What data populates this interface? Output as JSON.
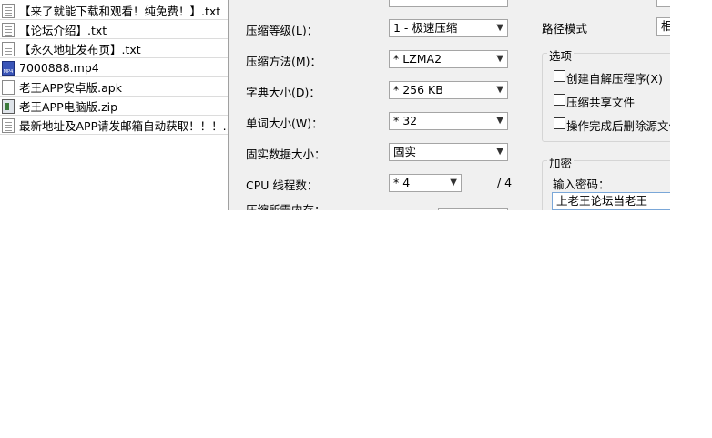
{
  "files": [
    {
      "name": "【来了就能下载和观看！纯免费！】.txt",
      "icon": "txt-file-icon"
    },
    {
      "name": "【论坛介绍】.txt",
      "icon": "txt-file-icon"
    },
    {
      "name": "【永久地址发布页】.txt",
      "icon": "txt-file-icon"
    },
    {
      "name": "7000888.mp4",
      "icon": "mp4-file-icon",
      "icon_text": "MP4"
    },
    {
      "name": "老王APP安卓版.apk",
      "icon": "apk-file-icon"
    },
    {
      "name": "老王APP电脑版.zip",
      "icon": "zip-file-icon"
    },
    {
      "name": "最新地址及APP请发邮箱自动获取！！！....",
      "icon": "txt-file-icon"
    }
  ],
  "dialog": {
    "compression_level": {
      "label": "压缩等级(L)：",
      "value": "1 - 极速压缩"
    },
    "compression_method": {
      "label": "压缩方法(M)：",
      "value": "* LZMA2"
    },
    "dictionary_size": {
      "label": "字典大小(D)：",
      "value": "* 256 KB"
    },
    "word_size": {
      "label": "单词大小(W)：",
      "value": "* 32"
    },
    "solid_block_size": {
      "label": "固实数据大小：",
      "value": "固实"
    },
    "cpu_threads": {
      "label": "CPU 线程数：",
      "value": "* 4",
      "max": "/ 4"
    },
    "memory_usage": {
      "label": "压缩所需内存："
    },
    "path_mode": {
      "label": "路径模式",
      "value": "相"
    },
    "options": {
      "title": "选项",
      "items": [
        {
          "label": "创建自解压程序(X)",
          "checked": false
        },
        {
          "label": "压缩共享文件",
          "checked": false
        },
        {
          "label": "操作完成后删除源文件",
          "checked": false
        }
      ]
    },
    "encryption": {
      "title": "加密",
      "password_label": "输入密码：",
      "password_value": "上老王论坛当老王"
    }
  },
  "colors": {
    "dialog_bg": "#f0f0f0",
    "input_border": "#a5a5a5",
    "focus_border": "#7aa7d8"
  }
}
